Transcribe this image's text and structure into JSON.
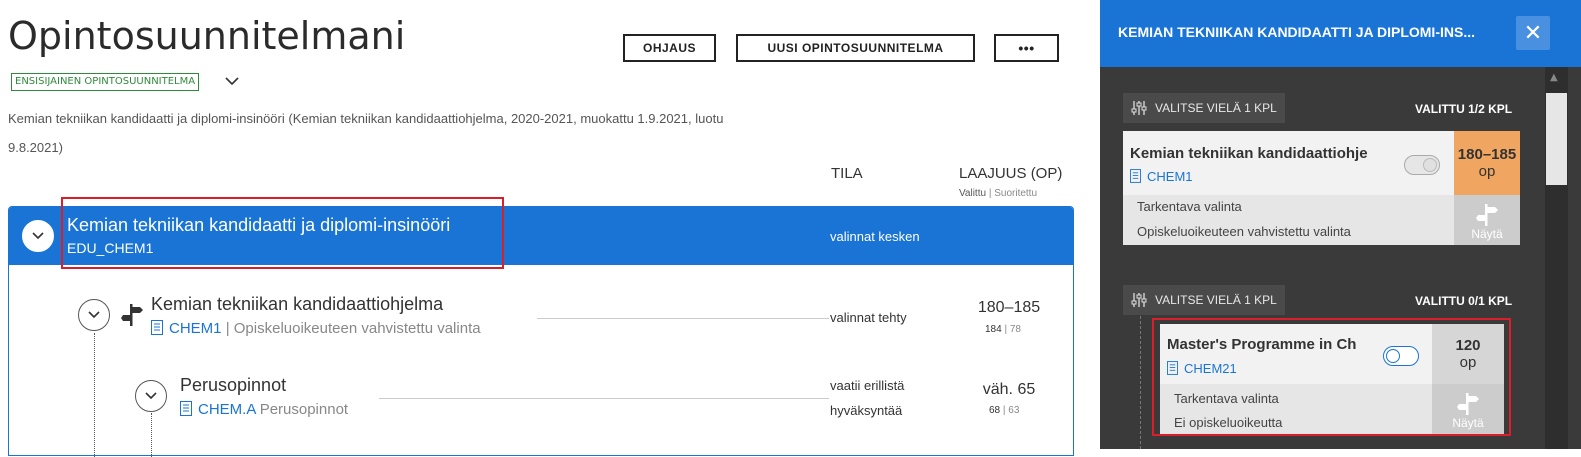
{
  "page": {
    "title": "Opintosuunnitelmani",
    "badge": "ENSISIJAINEN OPINTOSUUNNITELMA",
    "description": "Kemian tekniikan kandidaatti ja diplomi-insinööri (Kemian tekniikan kandidaattiohjelma, 2020-2021, muokattu 1.9.2021, luotu 9.8.2021)"
  },
  "toolbar": {
    "ohjaus": "OHJAUS",
    "new_plan": "UUSI OPINTOSUUNNITELMA",
    "more": "•••"
  },
  "columns": {
    "tila": "TILA",
    "laajuus": "LAAJUUS (OP)",
    "valittu": "Valittu",
    "suoritettu": "Suoritettu"
  },
  "tree": {
    "root": {
      "title": "Kemian tekniikan kandidaatti ja diplomi-insinööri",
      "code": "EDU_CHEM1",
      "state": "valinnat kesken"
    },
    "rows": [
      {
        "title": "Kemian tekniikan kandidaattiohjelma",
        "code": "CHEM1",
        "separator": "|",
        "note": "Opiskeluoikeuteen vahvistettu valinta",
        "state": "valinnat tehty",
        "credits": "180–185",
        "chosen": "184",
        "done": "78"
      },
      {
        "title": "Perusopinnot",
        "code": "CHEM.A",
        "note": "Perusopinnot",
        "state_line1": "vaatii erillistä",
        "state_line2": "hyväksyntää",
        "credits": "väh. 65",
        "chosen": "68",
        "done": "63"
      }
    ]
  },
  "panel": {
    "title": "KEMIAN TEKNIIKAN KANDIDAATTI JA DIPLOMI-INS...",
    "close": "✕",
    "groups": [
      {
        "select_label": "VALITSE VIELÄ 1 KPL",
        "chosen_label": "VALITTU 1/2 KPL",
        "card": {
          "title": "Kemian tekniikan kandidaattiohje",
          "code": "CHEM1",
          "credits": "180–185",
          "unit": "op",
          "line1": "Tarkentava valinta",
          "line2": "Opiskeluoikeuteen vahvistettu valinta",
          "show": "Näytä",
          "toggle_on": false
        }
      },
      {
        "select_label": "VALITSE VIELÄ 1 KPL",
        "chosen_label": "VALITTU 0/1 KPL",
        "card": {
          "title": "Master's Programme in Ch",
          "code": "CHEM21",
          "credits": "120",
          "unit": "op",
          "line1": "Tarkentava valinta",
          "line2": "Ei opiskeluoikeutta",
          "show": "Näytä",
          "toggle_on": false
        }
      }
    ]
  },
  "colors": {
    "accent": "#1a74d6",
    "highlight": "#d9202a",
    "badge": "#2e8b3a",
    "credit_orange": "#f0a560"
  }
}
